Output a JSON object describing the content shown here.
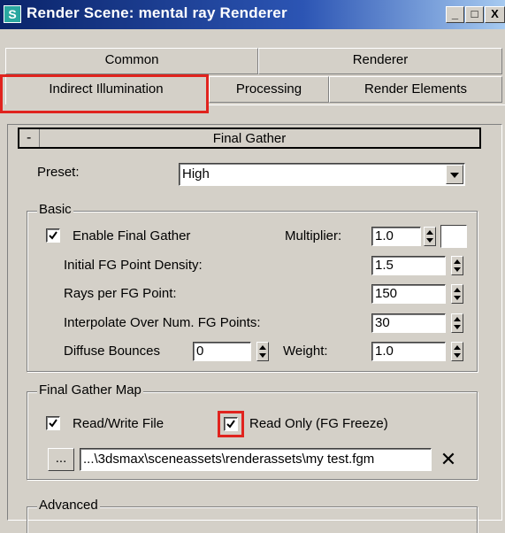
{
  "window": {
    "title": "Render Scene: mental ray Renderer",
    "icon_glyph": "S",
    "buttons": {
      "minimize": "_",
      "maximize": "□",
      "close": "X"
    }
  },
  "tabs": {
    "row1": [
      "Common",
      "Renderer"
    ],
    "row2": [
      "Indirect Illumination",
      "Processing",
      "Render Elements"
    ],
    "active": "Indirect Illumination"
  },
  "rollout": {
    "toggle": "-",
    "title": "Final Gather"
  },
  "preset": {
    "label": "Preset:",
    "value": "High"
  },
  "basic": {
    "group_label": "Basic",
    "enable_fg": {
      "label": "Enable Final Gather",
      "checked": true
    },
    "multiplier": {
      "label": "Multiplier:",
      "value": "1.0",
      "swatch_color": "#ffffff"
    },
    "initial_density": {
      "label": "Initial FG Point Density:",
      "value": "1.5"
    },
    "rays_per_point": {
      "label": "Rays per FG Point:",
      "value": "150"
    },
    "interpolate": {
      "label": "Interpolate Over Num. FG Points:",
      "value": "30"
    },
    "diffuse_bounces": {
      "label": "Diffuse Bounces",
      "value": "0"
    },
    "weight": {
      "label": "Weight:",
      "value": "1.0"
    }
  },
  "fg_map": {
    "group_label": "Final Gather Map",
    "read_write": {
      "label": "Read/Write File",
      "checked": true
    },
    "read_only": {
      "label": "Read Only (FG Freeze)",
      "checked": true
    },
    "browse_label": "...",
    "file_path": "...\\3dsmax\\sceneassets\\renderassets\\my test.fgm",
    "clear_label": "✕"
  },
  "advanced": {
    "group_label": "Advanced"
  },
  "colors": {
    "highlight_red": "#e0231e",
    "title_blue": "#0a246a"
  }
}
